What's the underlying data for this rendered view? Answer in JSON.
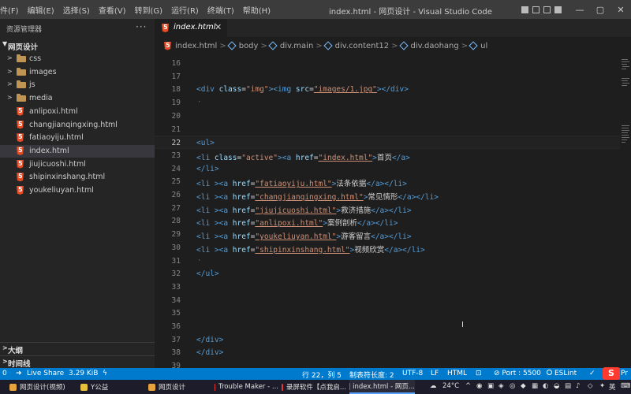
{
  "menu": [
    "件(F)",
    "编辑(E)",
    "选择(S)",
    "查看(V)",
    "转到(G)",
    "运行(R)",
    "终端(T)",
    "帮助(H)"
  ],
  "window_title": "index.html - 网页设计 - Visual Studio Code",
  "window_controls": {
    "minimize": "—",
    "maximize": "▢",
    "close": "✕"
  },
  "sidebar": {
    "header": "资源管理器",
    "more": "···",
    "root": "网页设计",
    "items": [
      {
        "label": "css",
        "type": "folder"
      },
      {
        "label": "images",
        "type": "folder"
      },
      {
        "label": "js",
        "type": "folder"
      },
      {
        "label": "media",
        "type": "folder"
      },
      {
        "label": "anlipoxi.html",
        "type": "html"
      },
      {
        "label": "changjianqingxing.html",
        "type": "html"
      },
      {
        "label": "fatiaoyiju.html",
        "type": "html"
      },
      {
        "label": "index.html",
        "type": "html",
        "active": true
      },
      {
        "label": "jiujicuoshi.html",
        "type": "html"
      },
      {
        "label": "shipinxinshang.html",
        "type": "html"
      },
      {
        "label": "youkeliuyan.html",
        "type": "html"
      }
    ],
    "outline": "大纲",
    "timeline": "时间线"
  },
  "tab": {
    "name": "index.html",
    "close": "✕"
  },
  "breadcrumb": [
    "index.html",
    "body",
    "div.main",
    "div.content12",
    "div.daohang",
    "ul"
  ],
  "editor": {
    "current_line": 22,
    "lines": [
      {
        "n": "16",
        "tokens": []
      },
      {
        "n": "17",
        "tokens": []
      },
      {
        "n": "18",
        "tokens": [
          [
            "t-tag",
            "<div "
          ],
          [
            "t-attr",
            "class"
          ],
          [
            "t-text",
            "="
          ],
          [
            "t-val",
            "\"img\""
          ],
          [
            "t-tag",
            ">"
          ],
          [
            "t-tag",
            "<img "
          ],
          [
            "t-attr",
            "src"
          ],
          [
            "t-text",
            "="
          ],
          [
            "t-val link",
            "\"images/1.jpg\""
          ],
          [
            "t-tag",
            "></div>"
          ]
        ]
      },
      {
        "n": "19",
        "tokens": [],
        "dot": true
      },
      {
        "n": "20",
        "tokens": []
      },
      {
        "n": "21",
        "tokens": []
      },
      {
        "n": "22",
        "tokens": [
          [
            "t-tag",
            "<ul>"
          ]
        ]
      },
      {
        "n": "23",
        "tokens": [
          [
            "t-tag",
            "<li "
          ],
          [
            "t-attr",
            "class"
          ],
          [
            "t-text",
            "="
          ],
          [
            "t-val",
            "\"active\""
          ],
          [
            "t-tag",
            ">"
          ],
          [
            "t-tag",
            "<a "
          ],
          [
            "t-attr",
            "href"
          ],
          [
            "t-text",
            "="
          ],
          [
            "t-val link",
            "\"index.html\""
          ],
          [
            "t-tag",
            ">"
          ],
          [
            "t-text",
            "首页"
          ],
          [
            "t-tag",
            "</a>"
          ]
        ]
      },
      {
        "n": "24",
        "tokens": [
          [
            "t-tag",
            "</li>"
          ]
        ]
      },
      {
        "n": "25",
        "tokens": [
          [
            "t-tag",
            "<li "
          ],
          [
            "t-tag",
            "><a "
          ],
          [
            "t-attr",
            "href"
          ],
          [
            "t-text",
            "="
          ],
          [
            "t-val link",
            "\"fatiaoyiju.html\""
          ],
          [
            "t-tag",
            ">"
          ],
          [
            "t-text",
            "法条依据"
          ],
          [
            "t-tag",
            "</a></li>"
          ]
        ]
      },
      {
        "n": "26",
        "tokens": [
          [
            "t-tag",
            "<li "
          ],
          [
            "t-tag",
            "><a "
          ],
          [
            "t-attr",
            "href"
          ],
          [
            "t-text",
            "="
          ],
          [
            "t-val link",
            "\"changjianqingxing.html\""
          ],
          [
            "t-tag",
            ">"
          ],
          [
            "t-text",
            "常见情形"
          ],
          [
            "t-tag",
            "</a></li>"
          ]
        ]
      },
      {
        "n": "27",
        "tokens": [
          [
            "t-tag",
            "<li "
          ],
          [
            "t-tag",
            "><a "
          ],
          [
            "t-attr",
            "href"
          ],
          [
            "t-text",
            "="
          ],
          [
            "t-val link",
            "\"jiujicuoshi.html\""
          ],
          [
            "t-tag",
            ">"
          ],
          [
            "t-text",
            "救济措施"
          ],
          [
            "t-tag",
            "</a></li>"
          ]
        ]
      },
      {
        "n": "28",
        "tokens": [
          [
            "t-tag",
            "<li "
          ],
          [
            "t-tag",
            "><a "
          ],
          [
            "t-attr",
            "href"
          ],
          [
            "t-text",
            "="
          ],
          [
            "t-val link",
            "\"anlipoxi.html\""
          ],
          [
            "t-tag",
            ">"
          ],
          [
            "t-text",
            "案例剖析"
          ],
          [
            "t-tag",
            "</a></li>"
          ]
        ]
      },
      {
        "n": "29",
        "tokens": [
          [
            "t-tag",
            "<li "
          ],
          [
            "t-tag",
            "><a "
          ],
          [
            "t-attr",
            "href"
          ],
          [
            "t-text",
            "="
          ],
          [
            "t-val link",
            "\"youkeliuyan.html\""
          ],
          [
            "t-tag",
            ">"
          ],
          [
            "t-text",
            "游客留言"
          ],
          [
            "t-tag",
            "</a></li>"
          ]
        ]
      },
      {
        "n": "30",
        "tokens": [
          [
            "t-tag",
            "<li "
          ],
          [
            "t-tag",
            "><a "
          ],
          [
            "t-attr",
            "href"
          ],
          [
            "t-text",
            "="
          ],
          [
            "t-val link",
            "\"shipinxinshang.html\""
          ],
          [
            "t-tag",
            ">"
          ],
          [
            "t-text",
            "视频欣赏"
          ],
          [
            "t-tag",
            "</a></li>"
          ]
        ]
      },
      {
        "n": "31",
        "tokens": [],
        "dot": true
      },
      {
        "n": "32",
        "tokens": [
          [
            "t-tag",
            "</ul>"
          ]
        ]
      },
      {
        "n": "33",
        "tokens": []
      },
      {
        "n": "34",
        "tokens": []
      },
      {
        "n": "35",
        "tokens": []
      },
      {
        "n": "36",
        "tokens": []
      },
      {
        "n": "37",
        "tokens": [
          [
            "t-tag",
            "</div>"
          ]
        ]
      },
      {
        "n": "38",
        "tokens": [
          [
            "t-tag",
            "</div>"
          ]
        ]
      },
      {
        "n": "39",
        "tokens": []
      }
    ]
  },
  "statusbar": {
    "left": [
      "0",
      "Live Share",
      "3.29 KiB"
    ],
    "position": "行 22，列 5",
    "tab_size": "制表符长度: 2",
    "encoding": "UTF-8",
    "eol": "LF",
    "language": "HTML",
    "port": "Port : 5500",
    "eslint": "ESLint",
    "right_trunc": "Pr"
  },
  "taskbar": {
    "tasks": [
      {
        "label": "网页设计(视频)",
        "color": "#e6a23c"
      },
      {
        "label": "Y公益",
        "color": "#e6c23c"
      },
      {
        "label": "网页设计",
        "color": "#e6a23c"
      },
      {
        "label": "Trouble Maker - ...",
        "color": "#e53935"
      },
      {
        "label": "录屏软件【点我启...",
        "color": "#e53935"
      },
      {
        "label": "index.html - 网页...",
        "color": "#2f80ed",
        "active": true
      }
    ],
    "weather": "24°C",
    "ime": "英"
  }
}
